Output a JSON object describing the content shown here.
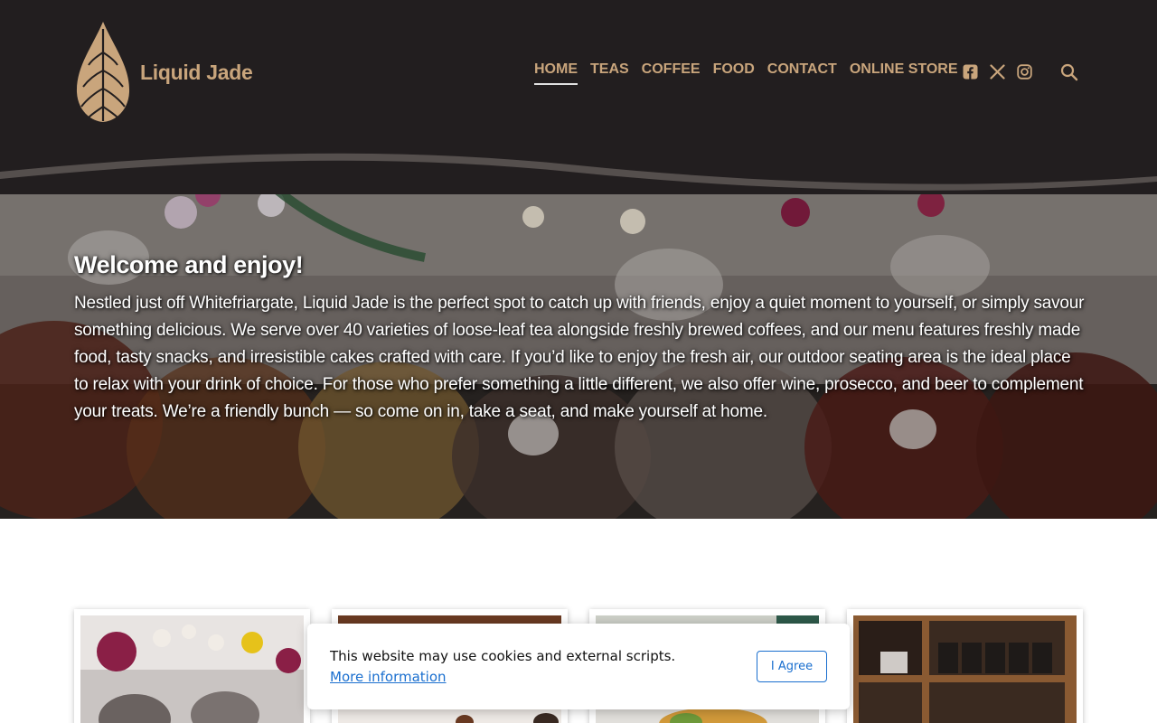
{
  "brand": {
    "name": "Liquid Jade",
    "logo_icon": "leaf-icon"
  },
  "nav": {
    "items": [
      {
        "label": "HOME",
        "active": true
      },
      {
        "label": "TEAS",
        "active": false
      },
      {
        "label": "COFFEE",
        "active": false
      },
      {
        "label": "FOOD",
        "active": false
      },
      {
        "label": "CONTACT",
        "active": false
      },
      {
        "label": "ONLINE STORE",
        "active": false
      }
    ]
  },
  "social": {
    "icons": [
      "facebook-icon",
      "x-icon",
      "instagram-icon"
    ]
  },
  "search": {
    "icon": "search-icon"
  },
  "hero": {
    "title": "Welcome and enjoy!",
    "text": "Nestled just off Whitefriargate, Liquid Jade is the perfect spot to catch up with friends, enjoy a quiet moment to yourself, or simply savour something delicious. We serve over 40 varieties of loose-leaf tea alongside freshly brewed coffees, and our menu features freshly made food, tasty snacks, and irresistible cakes crafted with care. If you’d like to enjoy the fresh air, our outdoor seating area is the ideal place to relax with your drink of choice. For those who prefer something a little different, we also offer wine, prosecco, and beer to complement your treats. We’re a friendly bunch — so come on in, take a seat, and make yourself at home."
  },
  "cookie": {
    "message": "This website may use cookies and external scripts.",
    "link": "More information",
    "button": "I Agree"
  },
  "colors": {
    "header_bg": "#221e1f",
    "accent": "#c9a57c",
    "link": "#1a6fcf"
  }
}
